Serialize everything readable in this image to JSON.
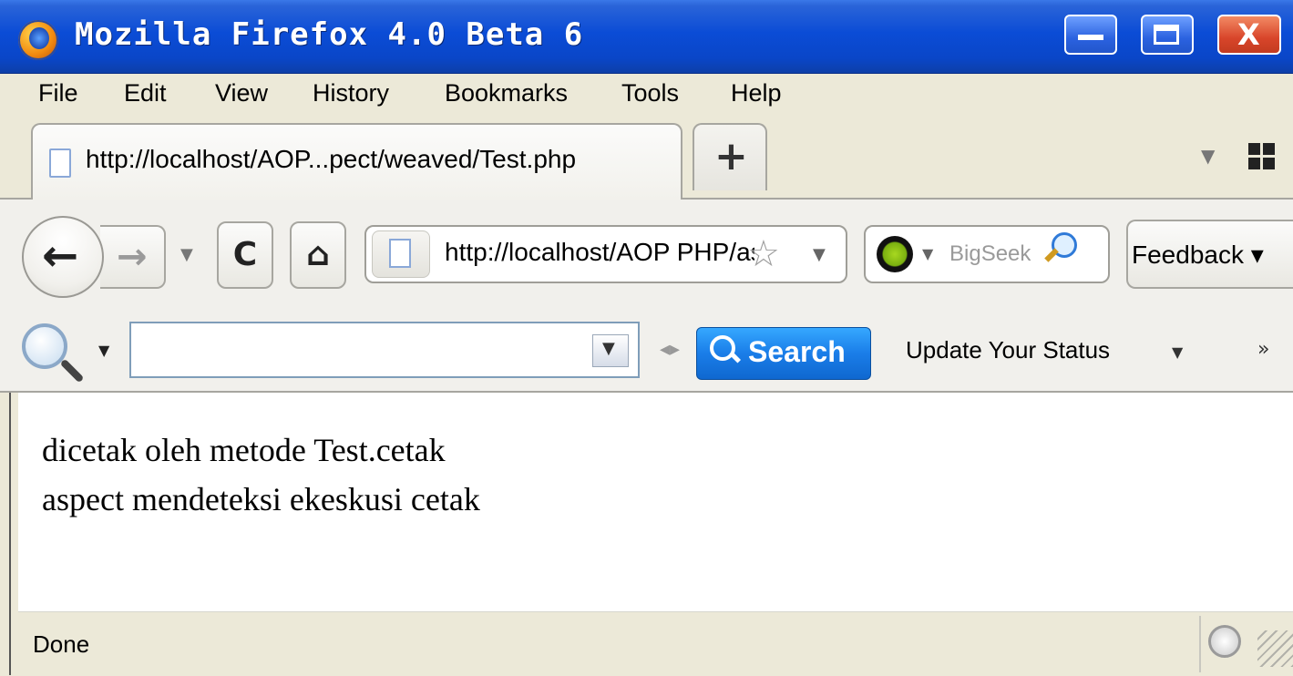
{
  "window": {
    "title": "Mozilla Firefox 4.0 Beta 6",
    "close_glyph": "X"
  },
  "menubar": {
    "items": [
      "File",
      "Edit",
      "View",
      "History",
      "Bookmarks",
      "Tools",
      "Help"
    ]
  },
  "tabs": {
    "active_title": "http://localhost/AOP...pect/weaved/Test.php",
    "new_tab_label": "+"
  },
  "navbar": {
    "back_glyph": "←",
    "forward_glyph": "→",
    "reload_glyph": "C",
    "home_glyph": "⌂",
    "url": "http://localhost/AOP PHP/aspect/weaved/Test.php",
    "star_glyph": "☆",
    "search_placeholder": "BigSeek",
    "feedback_label": "Feedback ▾"
  },
  "search_toolbar": {
    "input_value": "",
    "search_button_label": "Search",
    "status_label": "Update Your Status",
    "more_glyph": "»"
  },
  "content": {
    "lines": [
      "dicetak oleh metode Test.cetak",
      "aspect mendeteksi ekeskusi cetak"
    ]
  },
  "statusbar": {
    "text": "Done"
  },
  "icons": {
    "app": "firefox-logo-icon",
    "engine": "bigseek-engine-icon",
    "accent": "#1a7de8",
    "titlebar": "#0b4cd6"
  }
}
